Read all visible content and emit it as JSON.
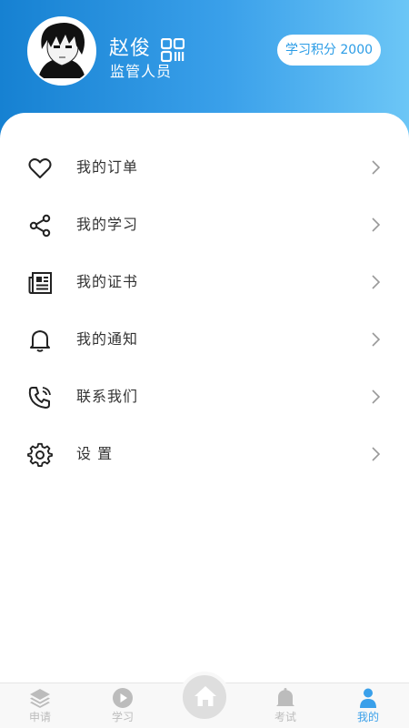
{
  "profile": {
    "name": "赵俊",
    "role": "监管人员",
    "points_label": "学习积分 2000"
  },
  "menu": {
    "items": [
      {
        "label": "我的订单",
        "icon": "heart-icon"
      },
      {
        "label": "我的学习",
        "icon": "share-icon"
      },
      {
        "label": "我的证书",
        "icon": "newspaper-icon"
      },
      {
        "label": "我的通知",
        "icon": "bell-icon"
      },
      {
        "label": "联系我们",
        "icon": "phone-icon"
      },
      {
        "label": "设 置",
        "icon": "gear-icon"
      }
    ]
  },
  "tabbar": {
    "tabs": [
      {
        "label": "申请",
        "icon": "layers-icon"
      },
      {
        "label": "学习",
        "icon": "play-icon"
      },
      {
        "label": "",
        "icon": "home-icon"
      },
      {
        "label": "考试",
        "icon": "bell-icon"
      },
      {
        "label": "我的",
        "icon": "person-icon",
        "active": true
      }
    ]
  },
  "colors": {
    "header_start": "#1681d2",
    "header_end": "#6cc6f6",
    "accent": "#3aa0ea",
    "tab_inactive": "#bcbcbc"
  }
}
